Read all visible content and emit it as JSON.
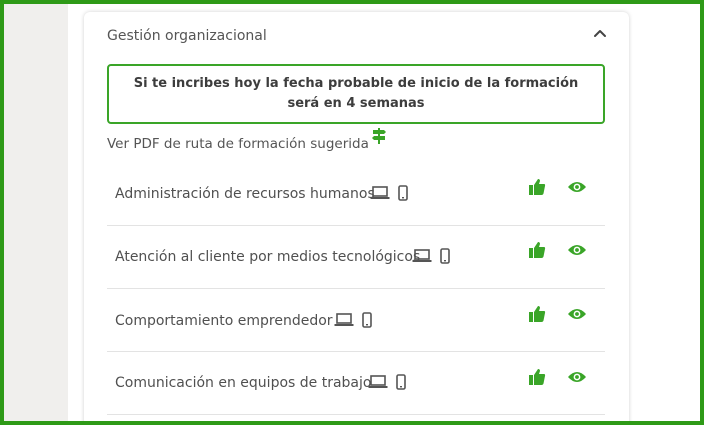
{
  "section": {
    "title": "Gestión organizacional"
  },
  "notice": {
    "text": "Si te incribes hoy la fecha probable de inicio de la formación será en 4 semanas"
  },
  "pdf": {
    "label": "Ver PDF de ruta de formación sugerida"
  },
  "courses": [
    {
      "name": "Administración de recursos humanos"
    },
    {
      "name": "Atención al cliente por medios tecnológicos"
    },
    {
      "name": "Comportamiento emprendedor"
    },
    {
      "name": "Comunicación en equipos de trabajo"
    }
  ],
  "colors": {
    "accent": "#2e9a17",
    "text": "#505050"
  },
  "icons": {
    "collapse": "chevron-up-icon",
    "pdf": "signpost-icon",
    "laptop": "laptop-icon",
    "mobile": "mobile-icon",
    "like": "thumbs-up-icon",
    "view": "eye-icon"
  }
}
